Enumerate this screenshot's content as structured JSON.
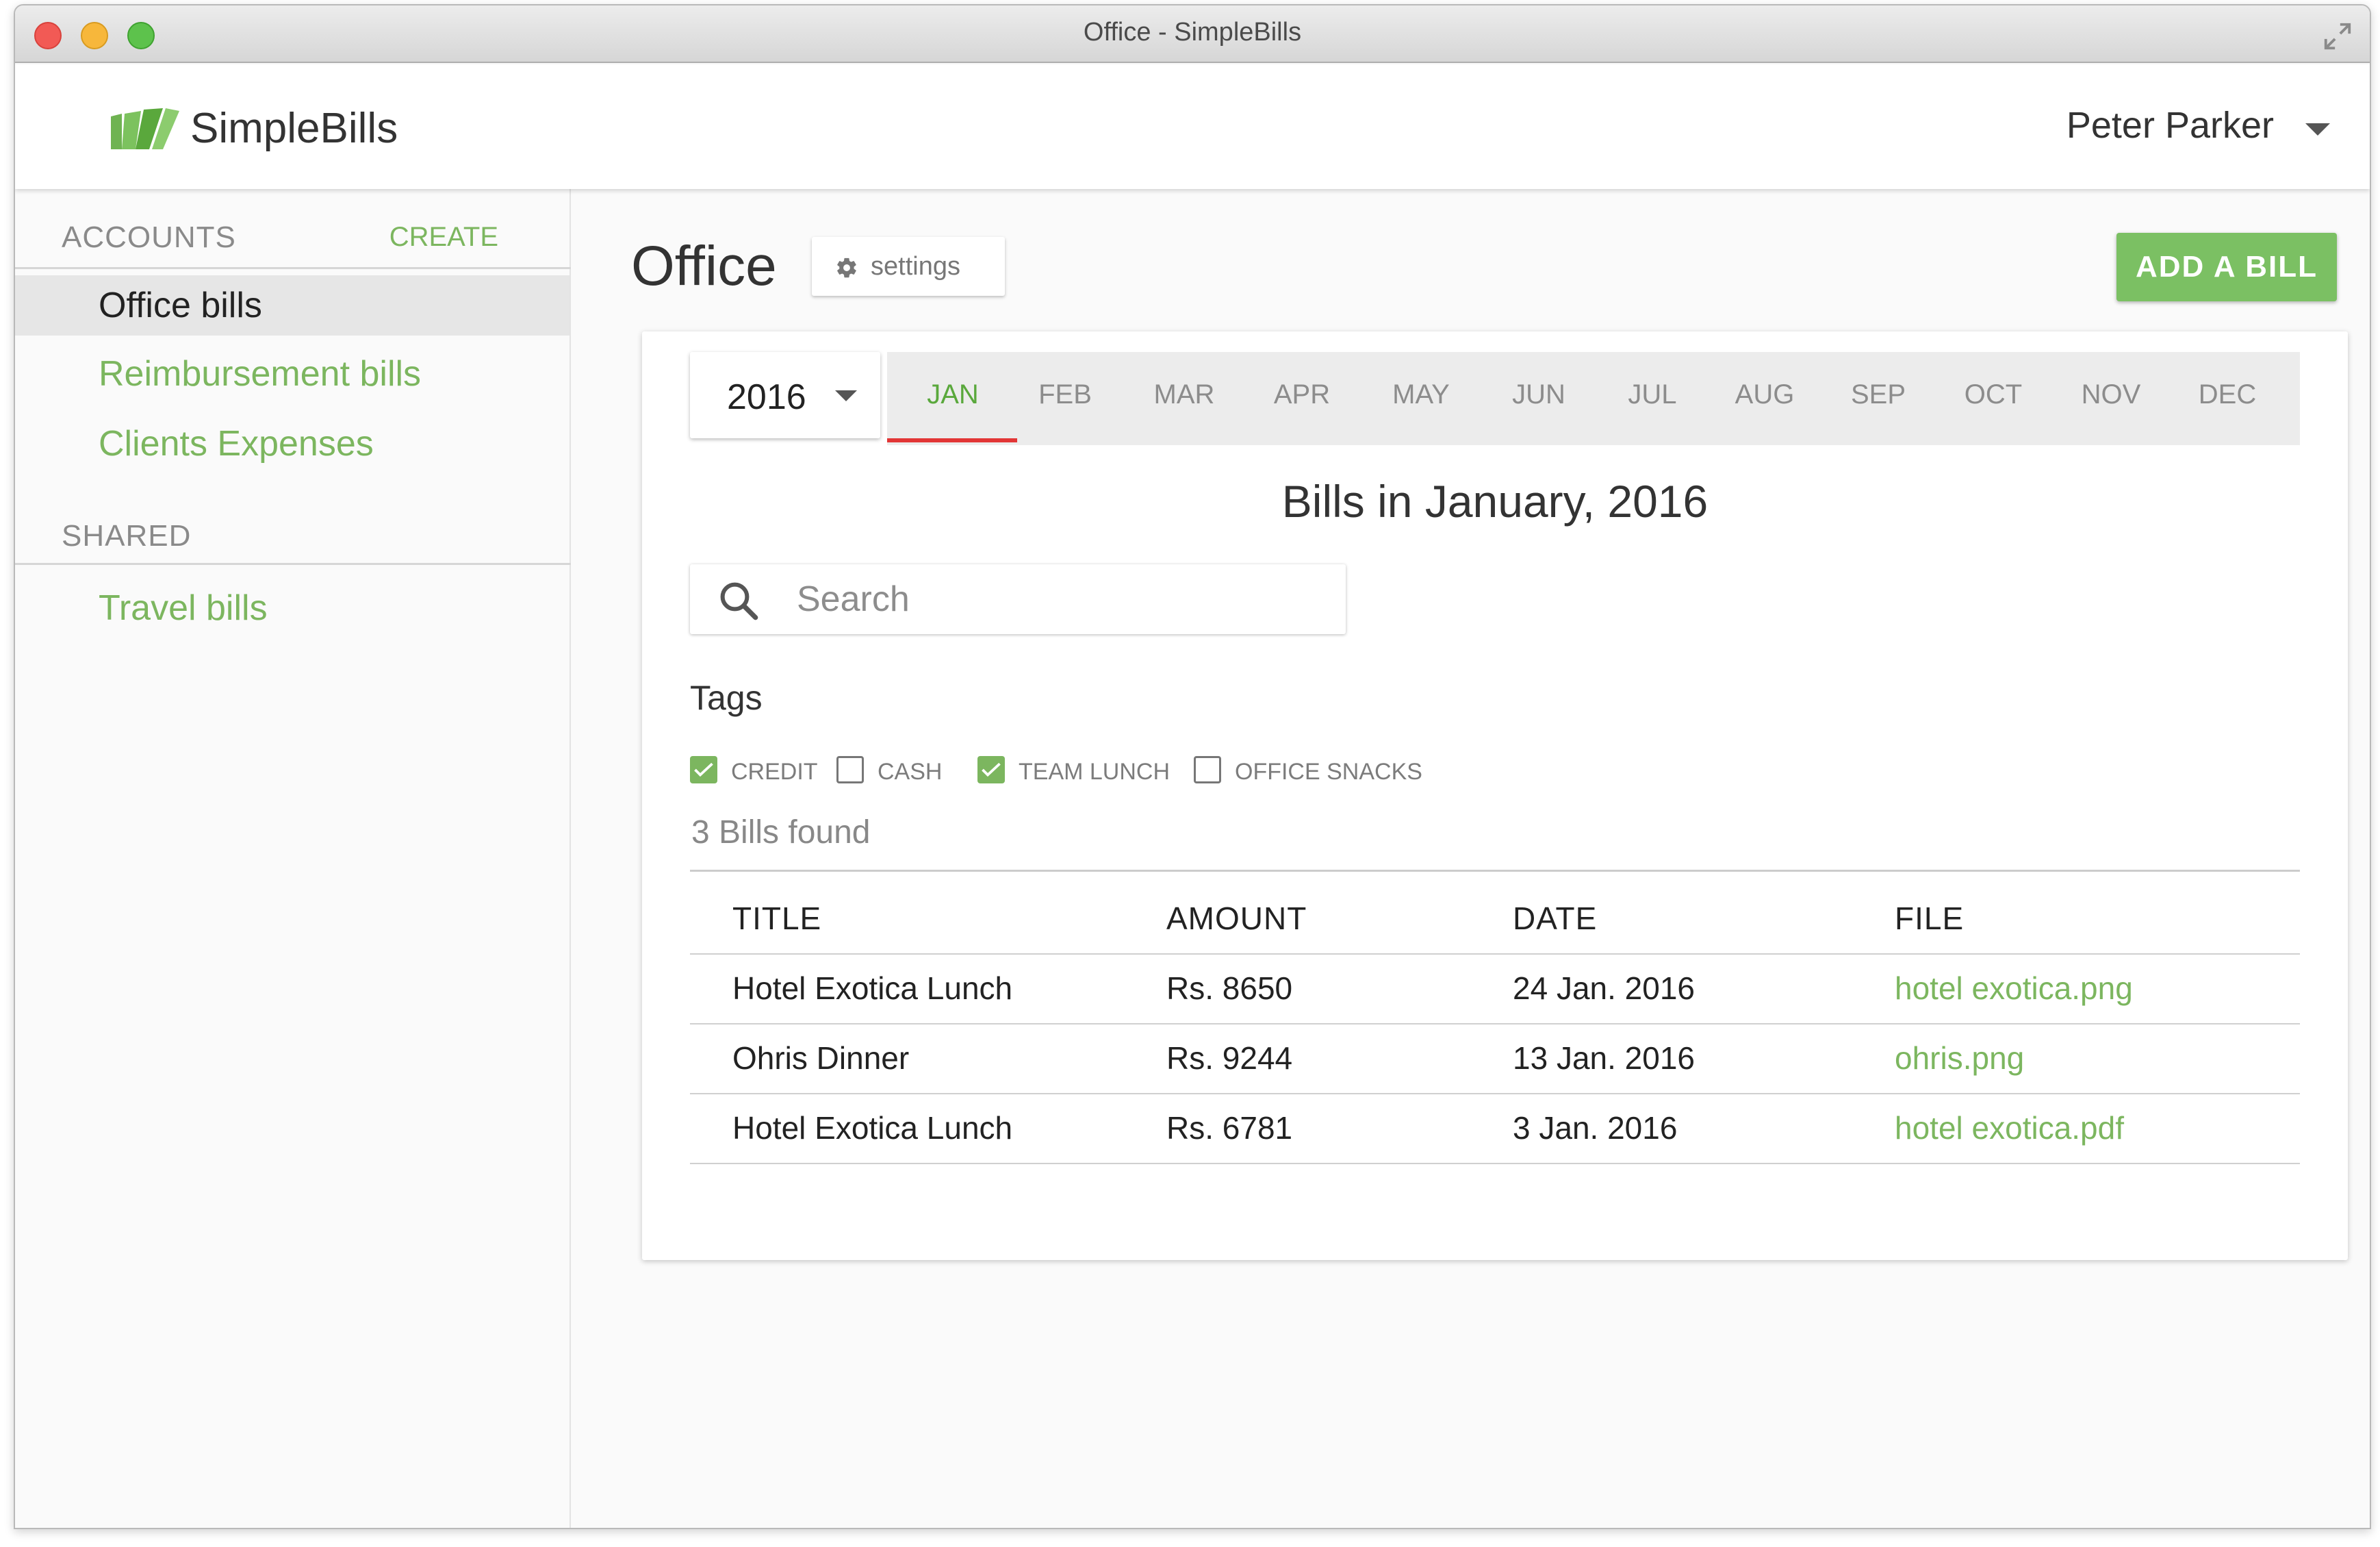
{
  "window": {
    "title": "Office - SimpleBills"
  },
  "header": {
    "brand": "SimpleBills",
    "user_name": "Peter Parker"
  },
  "sidebar": {
    "accounts_heading": "ACCOUNTS",
    "create_label": "CREATE",
    "accounts": [
      {
        "label": "Office bills",
        "active": true
      },
      {
        "label": "Reimbursement bills",
        "active": false
      },
      {
        "label": "Clients Expenses",
        "active": false
      }
    ],
    "shared_heading": "SHARED",
    "shared": [
      {
        "label": "Travel bills"
      }
    ]
  },
  "main": {
    "title": "Office",
    "settings_label": "settings",
    "add_bill_label": "ADD A BILL",
    "year": "2016",
    "months": [
      "JAN",
      "FEB",
      "MAR",
      "APR",
      "MAY",
      "JUN",
      "JUL",
      "AUG",
      "SEP",
      "OCT",
      "NOV",
      "DEC"
    ],
    "active_month": "JAN",
    "heading": "Bills in January, 2016",
    "search": {
      "placeholder": "Search",
      "value": ""
    },
    "tags_label": "Tags",
    "tags": [
      {
        "label": "CREDIT",
        "checked": true
      },
      {
        "label": "CASH",
        "checked": false
      },
      {
        "label": "TEAM LUNCH",
        "checked": true
      },
      {
        "label": "OFFICE SNACKS",
        "checked": false
      }
    ],
    "found_text": "3 Bills found",
    "table": {
      "columns": [
        "TITLE",
        "AMOUNT",
        "DATE",
        "FILE"
      ],
      "rows": [
        {
          "title": "Hotel Exotica Lunch",
          "amount": "Rs. 8650",
          "date": "24 Jan. 2016",
          "file": "hotel exotica.png"
        },
        {
          "title": "Ohris Dinner",
          "amount": "Rs. 9244",
          "date": "13 Jan. 2016",
          "file": "ohris.png"
        },
        {
          "title": "Hotel Exotica Lunch",
          "amount": "Rs. 6781",
          "date": "3 Jan. 2016",
          "file": "hotel exotica.pdf"
        }
      ]
    }
  },
  "colors": {
    "accent": "#7cb65f",
    "button": "#7bc063",
    "month_indicator": "#e23636"
  }
}
